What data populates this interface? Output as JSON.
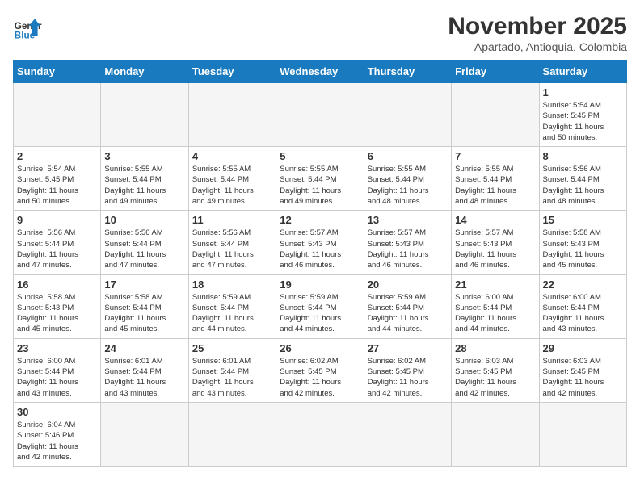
{
  "header": {
    "logo_general": "General",
    "logo_blue": "Blue",
    "month_year": "November 2025",
    "location": "Apartado, Antioquia, Colombia"
  },
  "weekdays": [
    "Sunday",
    "Monday",
    "Tuesday",
    "Wednesday",
    "Thursday",
    "Friday",
    "Saturday"
  ],
  "weeks": [
    [
      {
        "day": "",
        "info": ""
      },
      {
        "day": "",
        "info": ""
      },
      {
        "day": "",
        "info": ""
      },
      {
        "day": "",
        "info": ""
      },
      {
        "day": "",
        "info": ""
      },
      {
        "day": "",
        "info": ""
      },
      {
        "day": "1",
        "info": "Sunrise: 5:54 AM\nSunset: 5:45 PM\nDaylight: 11 hours\nand 50 minutes."
      }
    ],
    [
      {
        "day": "2",
        "info": "Sunrise: 5:54 AM\nSunset: 5:45 PM\nDaylight: 11 hours\nand 50 minutes."
      },
      {
        "day": "3",
        "info": "Sunrise: 5:55 AM\nSunset: 5:44 PM\nDaylight: 11 hours\nand 49 minutes."
      },
      {
        "day": "4",
        "info": "Sunrise: 5:55 AM\nSunset: 5:44 PM\nDaylight: 11 hours\nand 49 minutes."
      },
      {
        "day": "5",
        "info": "Sunrise: 5:55 AM\nSunset: 5:44 PM\nDaylight: 11 hours\nand 49 minutes."
      },
      {
        "day": "6",
        "info": "Sunrise: 5:55 AM\nSunset: 5:44 PM\nDaylight: 11 hours\nand 48 minutes."
      },
      {
        "day": "7",
        "info": "Sunrise: 5:55 AM\nSunset: 5:44 PM\nDaylight: 11 hours\nand 48 minutes."
      },
      {
        "day": "8",
        "info": "Sunrise: 5:56 AM\nSunset: 5:44 PM\nDaylight: 11 hours\nand 48 minutes."
      }
    ],
    [
      {
        "day": "9",
        "info": "Sunrise: 5:56 AM\nSunset: 5:44 PM\nDaylight: 11 hours\nand 47 minutes."
      },
      {
        "day": "10",
        "info": "Sunrise: 5:56 AM\nSunset: 5:44 PM\nDaylight: 11 hours\nand 47 minutes."
      },
      {
        "day": "11",
        "info": "Sunrise: 5:56 AM\nSunset: 5:44 PM\nDaylight: 11 hours\nand 47 minutes."
      },
      {
        "day": "12",
        "info": "Sunrise: 5:57 AM\nSunset: 5:43 PM\nDaylight: 11 hours\nand 46 minutes."
      },
      {
        "day": "13",
        "info": "Sunrise: 5:57 AM\nSunset: 5:43 PM\nDaylight: 11 hours\nand 46 minutes."
      },
      {
        "day": "14",
        "info": "Sunrise: 5:57 AM\nSunset: 5:43 PM\nDaylight: 11 hours\nand 46 minutes."
      },
      {
        "day": "15",
        "info": "Sunrise: 5:58 AM\nSunset: 5:43 PM\nDaylight: 11 hours\nand 45 minutes."
      }
    ],
    [
      {
        "day": "16",
        "info": "Sunrise: 5:58 AM\nSunset: 5:43 PM\nDaylight: 11 hours\nand 45 minutes."
      },
      {
        "day": "17",
        "info": "Sunrise: 5:58 AM\nSunset: 5:44 PM\nDaylight: 11 hours\nand 45 minutes."
      },
      {
        "day": "18",
        "info": "Sunrise: 5:59 AM\nSunset: 5:44 PM\nDaylight: 11 hours\nand 44 minutes."
      },
      {
        "day": "19",
        "info": "Sunrise: 5:59 AM\nSunset: 5:44 PM\nDaylight: 11 hours\nand 44 minutes."
      },
      {
        "day": "20",
        "info": "Sunrise: 5:59 AM\nSunset: 5:44 PM\nDaylight: 11 hours\nand 44 minutes."
      },
      {
        "day": "21",
        "info": "Sunrise: 6:00 AM\nSunset: 5:44 PM\nDaylight: 11 hours\nand 44 minutes."
      },
      {
        "day": "22",
        "info": "Sunrise: 6:00 AM\nSunset: 5:44 PM\nDaylight: 11 hours\nand 43 minutes."
      }
    ],
    [
      {
        "day": "23",
        "info": "Sunrise: 6:00 AM\nSunset: 5:44 PM\nDaylight: 11 hours\nand 43 minutes."
      },
      {
        "day": "24",
        "info": "Sunrise: 6:01 AM\nSunset: 5:44 PM\nDaylight: 11 hours\nand 43 minutes."
      },
      {
        "day": "25",
        "info": "Sunrise: 6:01 AM\nSunset: 5:44 PM\nDaylight: 11 hours\nand 43 minutes."
      },
      {
        "day": "26",
        "info": "Sunrise: 6:02 AM\nSunset: 5:45 PM\nDaylight: 11 hours\nand 42 minutes."
      },
      {
        "day": "27",
        "info": "Sunrise: 6:02 AM\nSunset: 5:45 PM\nDaylight: 11 hours\nand 42 minutes."
      },
      {
        "day": "28",
        "info": "Sunrise: 6:03 AM\nSunset: 5:45 PM\nDaylight: 11 hours\nand 42 minutes."
      },
      {
        "day": "29",
        "info": "Sunrise: 6:03 AM\nSunset: 5:45 PM\nDaylight: 11 hours\nand 42 minutes."
      }
    ],
    [
      {
        "day": "30",
        "info": "Sunrise: 6:04 AM\nSunset: 5:46 PM\nDaylight: 11 hours\nand 42 minutes."
      },
      {
        "day": "",
        "info": ""
      },
      {
        "day": "",
        "info": ""
      },
      {
        "day": "",
        "info": ""
      },
      {
        "day": "",
        "info": ""
      },
      {
        "day": "",
        "info": ""
      },
      {
        "day": "",
        "info": ""
      }
    ]
  ]
}
